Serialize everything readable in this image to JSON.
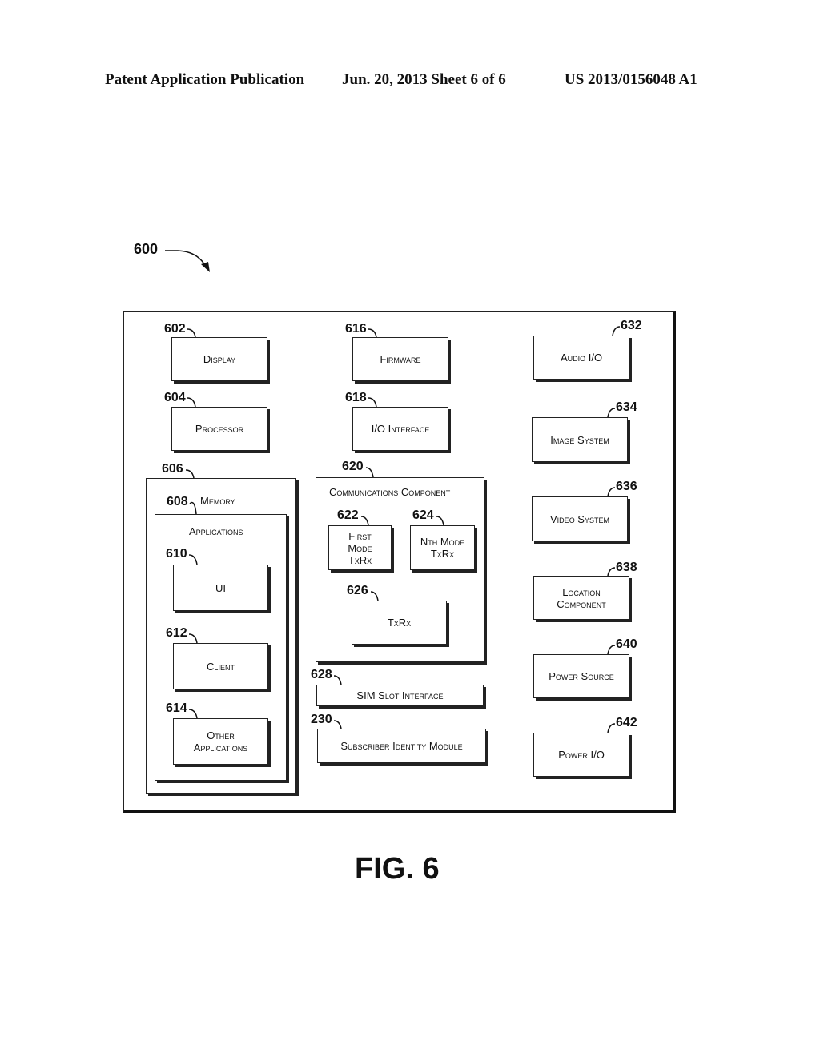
{
  "header": {
    "left": "Patent Application Publication",
    "middle": "Jun. 20, 2013  Sheet 6 of 6",
    "right": "US 2013/0156048 A1"
  },
  "figure": {
    "ref": "600",
    "caption": "FIG. 6"
  },
  "column1": {
    "display": {
      "ref": "602",
      "label": "Display"
    },
    "processor": {
      "ref": "604",
      "label": "Processor"
    },
    "memory_outer": {
      "ref": "606"
    },
    "memory": {
      "ref": "608",
      "label": "Memory"
    },
    "applications_label": "Applications",
    "ui": {
      "ref": "610",
      "label": "UI"
    },
    "client": {
      "ref": "612",
      "label": "Client"
    },
    "other_apps": {
      "ref": "614",
      "label": "Other\nApplications"
    }
  },
  "column2": {
    "firmware": {
      "ref": "616",
      "label": "Firmware"
    },
    "io_interface": {
      "ref": "618",
      "label": "I/O Interface"
    },
    "comms": {
      "ref": "620",
      "label": "Communications Component"
    },
    "first_mode": {
      "ref": "622",
      "label": "First\nMode\nTxRx"
    },
    "nth_mode": {
      "ref": "624",
      "label": "Nth Mode\nTxRx"
    },
    "txrx": {
      "ref": "626",
      "label": "TxRx"
    },
    "sim_slot": {
      "ref": "628",
      "label": "SIM Slot Interface"
    },
    "sim": {
      "ref": "230",
      "label": "Subscriber Identity Module"
    }
  },
  "column3": {
    "audio": {
      "ref": "632",
      "label": "Audio I/O"
    },
    "image": {
      "ref": "634",
      "label": "Image System"
    },
    "video": {
      "ref": "636",
      "label": "Video System"
    },
    "location": {
      "ref": "638",
      "label": "Location\nComponent"
    },
    "power_source": {
      "ref": "640",
      "label": "Power Source"
    },
    "power_io": {
      "ref": "642",
      "label": "Power I/O"
    }
  }
}
